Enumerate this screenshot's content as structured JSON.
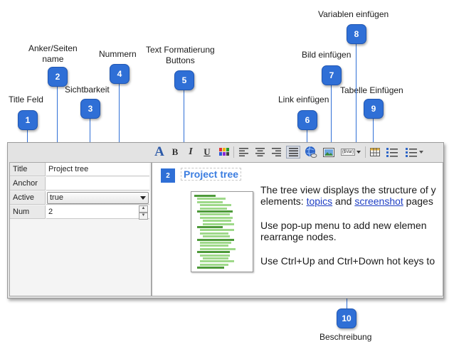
{
  "callouts": [
    {
      "id": "title-feld",
      "num": "1",
      "label": "Title Feld"
    },
    {
      "id": "anker",
      "num": "2",
      "label_line1": "Anker/Seiten",
      "label_line2": "name"
    },
    {
      "id": "sichtbarkeit",
      "num": "3",
      "label": "Sichtbarkeit"
    },
    {
      "id": "nummern",
      "num": "4",
      "label": "Nummern"
    },
    {
      "id": "text-format",
      "num": "5",
      "label_line1": "Text Formatierung",
      "label_line2": "Buttons"
    },
    {
      "id": "link",
      "num": "6",
      "label": "Link einfügen"
    },
    {
      "id": "bild",
      "num": "7",
      "label": "Bild einfügen"
    },
    {
      "id": "variablen",
      "num": "8",
      "label": "Variablen einfügen"
    },
    {
      "id": "tabelle",
      "num": "9",
      "label": "Tabelle Einfügen"
    },
    {
      "id": "beschreibung",
      "num": "10",
      "label": "Beschreibung"
    }
  ],
  "properties": {
    "title": {
      "label": "Title",
      "value": "Project tree"
    },
    "anchor": {
      "label": "Anchor",
      "value": ""
    },
    "active": {
      "label": "Active",
      "value": "true"
    },
    "num": {
      "label": "Num",
      "value": "2"
    }
  },
  "toolbar": {
    "font_glyph": "A",
    "bold": "B",
    "italic": "I",
    "underline": "U",
    "var_glyph": "{$Var}",
    "icons": [
      "font-style-icon",
      "bold-icon",
      "italic-icon",
      "underline-icon",
      "color-icon",
      "align-left-icon",
      "align-center-icon",
      "align-right-icon",
      "justify-icon",
      "insert-link-icon",
      "insert-image-icon",
      "insert-variable-icon",
      "insert-table-icon",
      "bullet-list-icon",
      "numbered-list-icon"
    ]
  },
  "editor": {
    "topic_number": "2",
    "topic_title": "Project tree",
    "p1_line1": "The tree view displays the structure of y",
    "p1_line2_a": "elements: ",
    "p1_link1": "topics",
    "p1_line2_b": " and ",
    "p1_link2": "screenshot",
    "p1_line2_c": " pages",
    "p2_line1": "Use pop-up menu to add new elemen",
    "p2_line2": "rearrange nodes.",
    "p3_line1": "Use Ctrl+Up and Ctrl+Down hot keys to"
  },
  "colors": {
    "accent": "#2f6fd6",
    "link": "#1f3fc4",
    "title": "#3b7de0"
  }
}
